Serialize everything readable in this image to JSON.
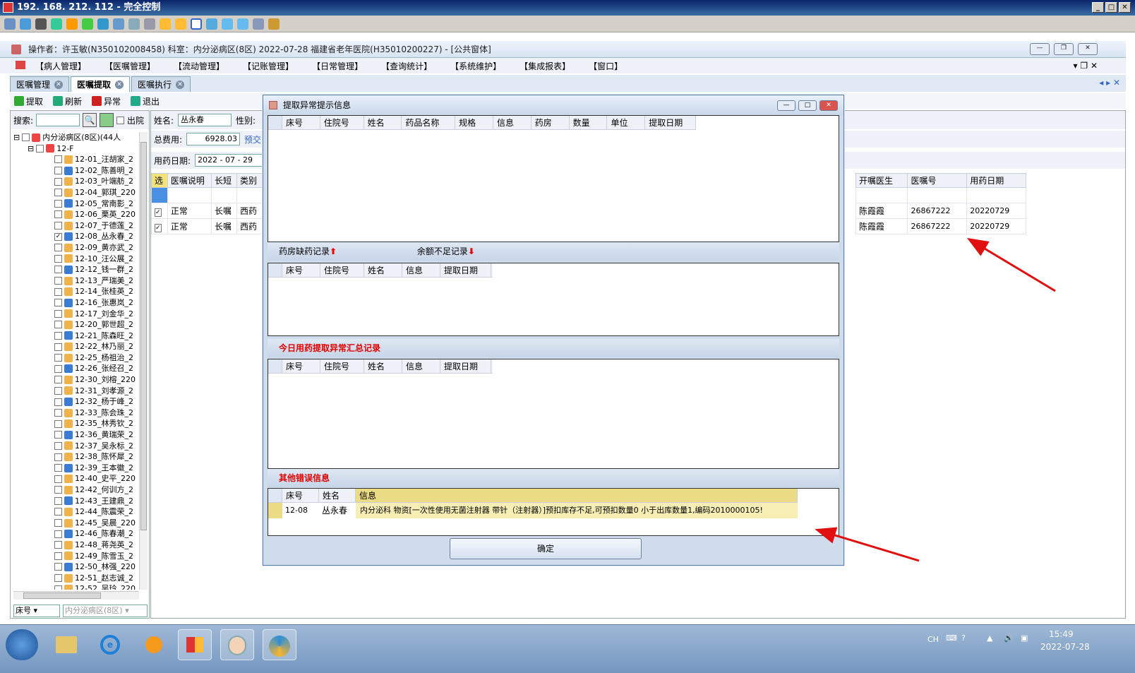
{
  "remote_title": "192. 168. 212. 112 - 完全控制",
  "app_title": "操作者：许玉敏(N350102008458)  科室：内分泌病区(8区)  2022-07-28  福建省老年医院(H35010200227) - [公共窗体]",
  "menu": [
    "【病人管理】",
    "【医嘱管理】",
    "【流动管理】",
    "【记账管理】",
    "【日常管理】",
    "【查询统计】",
    "【系统维护】",
    "【集成报表】",
    "【窗口】"
  ],
  "tabs": [
    "医嘱管理",
    "医嘱提取",
    "医嘱执行"
  ],
  "actions": [
    "提取",
    "刷新",
    "异常",
    "退出"
  ],
  "left": {
    "search_label": "搜索:",
    "discharge_label": "出院",
    "root": "内分泌病区(8区)(44人",
    "floor": "12-F",
    "patients": [
      "12-01_汪胡家_2",
      "12-02_陈善明_2",
      "12-03_叶端舫_2",
      "12-04_郭琪_220",
      "12-05_常南影_2",
      "12-06_栗英_220",
      "12-07_于德莲_2",
      "12-08_丛永春_2",
      "12-09_黄亦武_2",
      "12-10_汪公展_2",
      "12-12_钱一群_2",
      "12-13_严瑞美_2",
      "12-14_张桂英_2",
      "12-16_张惠岚_2",
      "12-17_刘金华_2",
      "12-20_郭世超_2",
      "12-21_陈森旺_2",
      "12-22_林乃丽_2",
      "12-25_杨祖治_2",
      "12-26_张经召_2",
      "12-30_刘榕_220",
      "12-31_刘孝源_2",
      "12-32_杨于峰_2",
      "12-33_陈会珠_2",
      "12-35_林秀钦_2",
      "12-36_黄瑞荣_2",
      "12-37_吴永标_2",
      "12-38_陈怀犀_2",
      "12-39_王本徽_2",
      "12-40_史平_220",
      "12-42_何训方_2",
      "12-43_王建鼎_2",
      "12-44_陈震荣_2",
      "12-45_吴晨_220",
      "12-46_陈春潮_2",
      "12-48_蒋尧英_2",
      "12-49_陈雪玉_2",
      "12-50_林强_220",
      "12-51_赵志诚_2",
      "12-52_吴玲_220"
    ],
    "checked_index": 7,
    "sort_label": "床号",
    "ward_combo": "内分泌病区(8区)"
  },
  "right": {
    "name_label": "姓名:",
    "name_value": "丛永春",
    "sex_label": "性别:",
    "total_label": "总费用:",
    "total_value": "6928.03",
    "prepay_label": "预交",
    "date_label": "用药日期:",
    "date_value": "2022 - 07 - 29",
    "grid_left_headers": [
      "选",
      "医嘱说明",
      "长短",
      "类别"
    ],
    "grid_right_headers": [
      "开嘱医生",
      "医嘱号",
      "用药日期"
    ],
    "rows": [
      {
        "desc": "正常",
        "term": "长嘱",
        "type": "西药",
        "doctor": "陈霞霞",
        "order": "26867222",
        "date": "20220729"
      },
      {
        "desc": "正常",
        "term": "长嘱",
        "type": "西药",
        "doctor": "陈霞霞",
        "order": "26867222",
        "date": "20220729"
      }
    ]
  },
  "dialog": {
    "title": "提取异常提示信息",
    "grid1_headers": [
      "床号",
      "住院号",
      "姓名",
      "药品名称",
      "规格",
      "信息",
      "药房",
      "数量",
      "单位",
      "提取日期"
    ],
    "section2_a": "药房缺药记录",
    "section2_b": "余额不足记录",
    "grid2_headers": [
      "床号",
      "住院号",
      "姓名",
      "信息",
      "提取日期"
    ],
    "section3": "今日用药提取异常汇总记录",
    "grid3_headers": [
      "床号",
      "住院号",
      "姓名",
      "信息",
      "提取日期"
    ],
    "section4": "其他错误信息",
    "grid4_headers": [
      "床号",
      "姓名",
      "信息"
    ],
    "grid4_row": {
      "bed": "12-08",
      "name": "丛永春",
      "info": "内分泌科 物资[一次性使用无菌注射器 带针（注射器）]预扣库存不足,可预扣数量0 小于出库数量1,编码2010000105!"
    },
    "ok": "确定"
  },
  "tray": {
    "lang": "CH",
    "time": "15:49",
    "date": "2022-07-28"
  }
}
